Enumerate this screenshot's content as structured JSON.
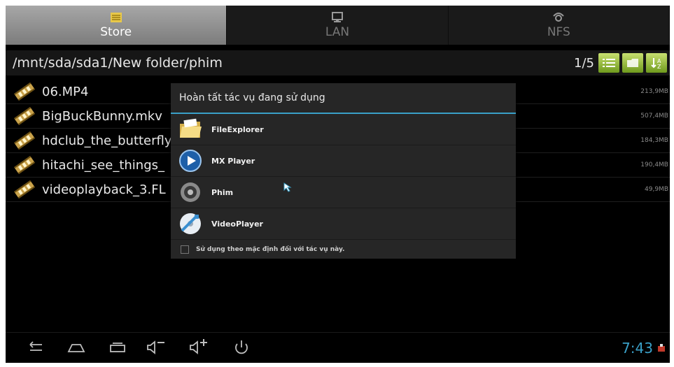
{
  "tabs": [
    {
      "label": "Store",
      "icon": "store-icon",
      "active": true
    },
    {
      "label": "LAN",
      "icon": "monitor-icon",
      "active": false
    },
    {
      "label": "NFS",
      "icon": "network-icon",
      "active": false
    }
  ],
  "path": "/mnt/sda/sda1/New folder/phim",
  "page": "1/5",
  "toolbar": {
    "list_view": "list-view-icon",
    "new_folder": "folder-icon",
    "sort": "sort-icon"
  },
  "files": [
    {
      "name": "06.MP4",
      "size": "213,9MB"
    },
    {
      "name": "BigBuckBunny.mkv",
      "size": "507,4MB"
    },
    {
      "name": "hdclub_the_butterfly",
      "size": "184,3MB"
    },
    {
      "name": "hitachi_see_things_",
      "size": "190,4MB"
    },
    {
      "name": "videoplayback_3.FL",
      "size": "49,9MB"
    }
  ],
  "dialog": {
    "title": "Hoàn tất tác vụ đang sử dụng",
    "apps": [
      {
        "label": "FileExplorer",
        "icon": "file-explorer-icon"
      },
      {
        "label": "MX Player",
        "icon": "mx-player-icon"
      },
      {
        "label": "Phim",
        "icon": "phim-icon"
      },
      {
        "label": "VideoPlayer",
        "icon": "video-player-icon"
      }
    ],
    "default_label": "Sử dụng theo mặc định đối với tác vụ này."
  },
  "statusbar": {
    "time": "7:43"
  },
  "colors": {
    "accent": "#3aa0c8",
    "toolbar_green": "#7aa826"
  }
}
